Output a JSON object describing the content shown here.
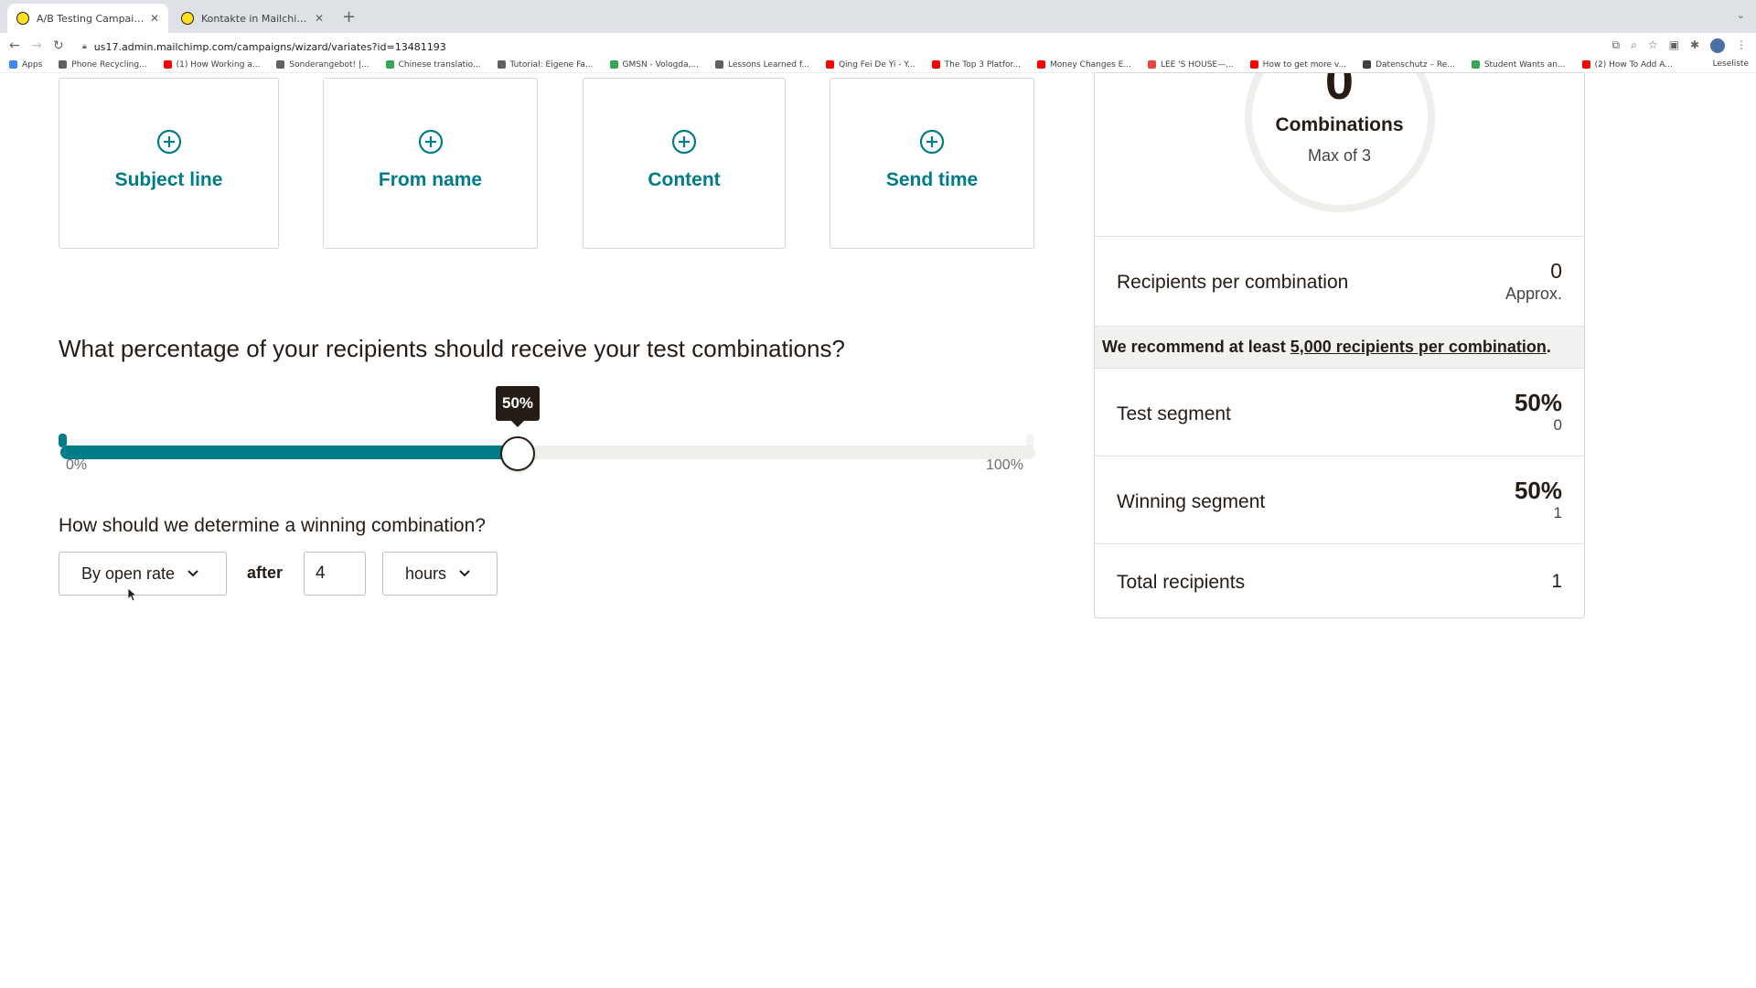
{
  "browser": {
    "tabs": [
      {
        "title": "A/B Testing Campaign Builder",
        "active": true
      },
      {
        "title": "Kontakte in Mailchimp importie",
        "active": false
      }
    ],
    "url": "us17.admin.mailchimp.com/campaigns/wizard/variates?id=13481193",
    "bookmarks": [
      {
        "label": "Apps",
        "color": "#4285f4"
      },
      {
        "label": "Phone Recycling...",
        "color": "#5f6368"
      },
      {
        "label": "(1) How Working a...",
        "color": "#ff0000"
      },
      {
        "label": "Sonderangebot! |...",
        "color": "#5f6368"
      },
      {
        "label": "Chinese translatio...",
        "color": "#34a853"
      },
      {
        "label": "Tutorial: Eigene Fa...",
        "color": "#5f6368"
      },
      {
        "label": "GMSN - Vologda,...",
        "color": "#34a853"
      },
      {
        "label": "Lessons Learned f...",
        "color": "#5f6368"
      },
      {
        "label": "Qing Fei De Yi - Y...",
        "color": "#ff0000"
      },
      {
        "label": "The Top 3 Platfor...",
        "color": "#ff0000"
      },
      {
        "label": "Money Changes E...",
        "color": "#ff0000"
      },
      {
        "label": "LEE 'S HOUSE—...",
        "color": "#e8453c"
      },
      {
        "label": "How to get more v...",
        "color": "#ff0000"
      },
      {
        "label": "Datenschutz – Re...",
        "color": "#3c4043"
      },
      {
        "label": "Student Wants an...",
        "color": "#34a853"
      },
      {
        "label": "(2) How To Add A...",
        "color": "#ff0000"
      }
    ],
    "reading_list": "Leseliste"
  },
  "variables": [
    {
      "label": "Subject line"
    },
    {
      "label": "From name"
    },
    {
      "label": "Content"
    },
    {
      "label": "Send time"
    }
  ],
  "test_percentage": {
    "question": "What percentage of your recipients should receive your test combinations?",
    "value_percent": 50,
    "tooltip": "50%",
    "min_label": "0%",
    "max_label": "100%"
  },
  "winner": {
    "question": "How should we determine a winning combination?",
    "metric": "By open rate",
    "after_label": "after",
    "duration_value": "4",
    "duration_unit": "hours"
  },
  "summary": {
    "combinations_count": "0",
    "combinations_label": "Combinations",
    "combinations_max": "Max of 3",
    "recipients_per_combination_label": "Recipients per combination",
    "recipients_per_combination_value": "0",
    "recipients_per_combination_sub": "Approx.",
    "recommend_prefix": "We recommend at least",
    "recommend_link": "5,000 recipients per combination",
    "recommend_suffix": ".",
    "test_segment_label": "Test segment",
    "test_segment_percent": "50%",
    "test_segment_count": "0",
    "winning_segment_label": "Winning segment",
    "winning_segment_percent": "50%",
    "winning_segment_count": "1",
    "total_recipients_label": "Total recipients",
    "total_recipients_value": "1"
  },
  "colors": {
    "accent": "#007c89",
    "text": "#241c15",
    "track": "#efeeea"
  }
}
